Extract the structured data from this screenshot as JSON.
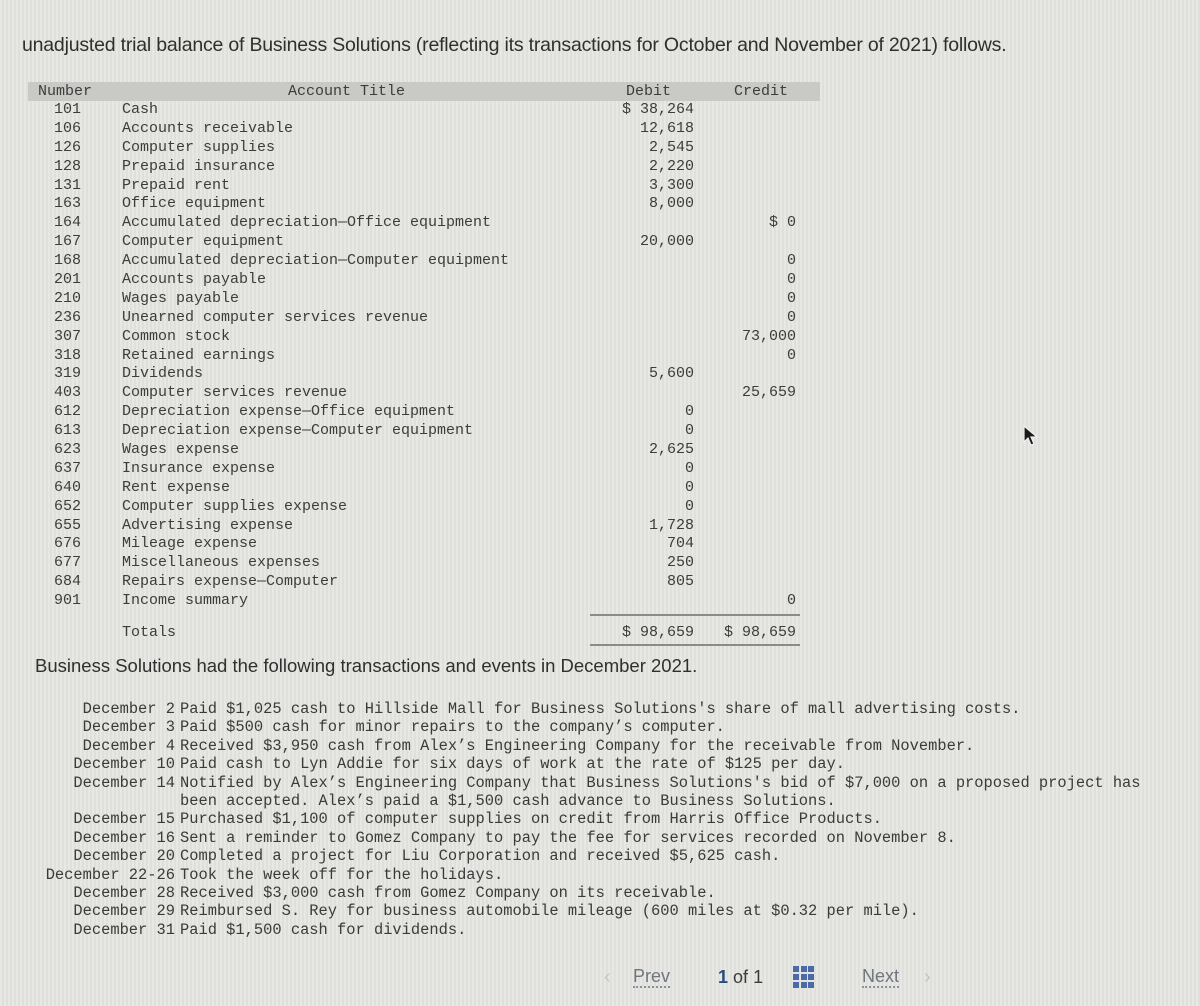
{
  "intro": "unadjusted trial balance of Business Solutions (reflecting its transactions for October and November of 2021) follows.",
  "trial_balance": {
    "headers": {
      "number": "Number",
      "title": "Account Title",
      "debit": "Debit",
      "credit": "Credit"
    },
    "rows": [
      {
        "number": "101",
        "title": "Cash",
        "debit": "$ 38,264",
        "credit": ""
      },
      {
        "number": "106",
        "title": "Accounts receivable",
        "debit": "12,618",
        "credit": ""
      },
      {
        "number": "126",
        "title": "Computer supplies",
        "debit": "2,545",
        "credit": ""
      },
      {
        "number": "128",
        "title": "Prepaid insurance",
        "debit": "2,220",
        "credit": ""
      },
      {
        "number": "131",
        "title": "Prepaid rent",
        "debit": "3,300",
        "credit": ""
      },
      {
        "number": "163",
        "title": "Office equipment",
        "debit": "8,000",
        "credit": ""
      },
      {
        "number": "164",
        "title": "Accumulated depreciation—Office equipment",
        "debit": "",
        "credit": "$ 0"
      },
      {
        "number": "167",
        "title": "Computer equipment",
        "debit": "20,000",
        "credit": ""
      },
      {
        "number": "168",
        "title": "Accumulated depreciation—Computer equipment",
        "debit": "",
        "credit": "0"
      },
      {
        "number": "201",
        "title": "Accounts payable",
        "debit": "",
        "credit": "0"
      },
      {
        "number": "210",
        "title": "Wages payable",
        "debit": "",
        "credit": "0"
      },
      {
        "number": "236",
        "title": "Unearned computer services revenue",
        "debit": "",
        "credit": "0"
      },
      {
        "number": "307",
        "title": "Common stock",
        "debit": "",
        "credit": "73,000"
      },
      {
        "number": "318",
        "title": "Retained earnings",
        "debit": "",
        "credit": "0"
      },
      {
        "number": "319",
        "title": "Dividends",
        "debit": "5,600",
        "credit": ""
      },
      {
        "number": "403",
        "title": "Computer services revenue",
        "debit": "",
        "credit": "25,659"
      },
      {
        "number": "612",
        "title": "Depreciation expense—Office equipment",
        "debit": "0",
        "credit": ""
      },
      {
        "number": "613",
        "title": "Depreciation expense—Computer equipment",
        "debit": "0",
        "credit": ""
      },
      {
        "number": "623",
        "title": "Wages expense",
        "debit": "2,625",
        "credit": ""
      },
      {
        "number": "637",
        "title": "Insurance expense",
        "debit": "0",
        "credit": ""
      },
      {
        "number": "640",
        "title": "Rent expense",
        "debit": "0",
        "credit": ""
      },
      {
        "number": "652",
        "title": "Computer supplies expense",
        "debit": "0",
        "credit": ""
      },
      {
        "number": "655",
        "title": "Advertising expense",
        "debit": "1,728",
        "credit": ""
      },
      {
        "number": "676",
        "title": "Mileage expense",
        "debit": "704",
        "credit": ""
      },
      {
        "number": "677",
        "title": "Miscellaneous expenses",
        "debit": "250",
        "credit": ""
      },
      {
        "number": "684",
        "title": "Repairs expense—Computer",
        "debit": "805",
        "credit": ""
      },
      {
        "number": "901",
        "title": "Income summary",
        "debit": "",
        "credit": "0"
      }
    ],
    "totals": {
      "label": "Totals",
      "debit": "$ 98,659",
      "credit": "$ 98,659"
    }
  },
  "transactions_intro": "Business Solutions had the following transactions and events in December 2021.",
  "transactions": [
    {
      "date": "December 2",
      "text": "Paid $1,025 cash to Hillside Mall for Business Solutions's share of mall advertising costs."
    },
    {
      "date": "December 3",
      "text": "Paid $500 cash for minor repairs to the company’s computer."
    },
    {
      "date": "December 4",
      "text": "Received $3,950 cash from Alex’s Engineering Company for the receivable from November."
    },
    {
      "date": "December 10",
      "text": "Paid cash to Lyn Addie for six days of work at the rate of $125 per day."
    },
    {
      "date": "December 14",
      "text": "Notified by Alex’s Engineering Company that Business Solutions's bid of $7,000 on a proposed project has been accepted. Alex’s paid a $1,500 cash advance to Business Solutions."
    },
    {
      "date": "December 15",
      "text": "Purchased $1,100 of computer supplies on credit from Harris Office Products."
    },
    {
      "date": "December 16",
      "text": "Sent a reminder to Gomez Company to pay the fee for services recorded on November 8."
    },
    {
      "date": "December 20",
      "text": "Completed a project for Liu Corporation and received $5,625 cash."
    },
    {
      "date": "December 22-26",
      "text": "Took the week off for the holidays."
    },
    {
      "date": "December 28",
      "text": "Received $3,000 cash from Gomez Company on its receivable."
    },
    {
      "date": "December 29",
      "text": "Reimbursed S. Rey for business automobile mileage (600 miles at $0.32 per mile)."
    },
    {
      "date": "December 31",
      "text": "Paid $1,500 cash for dividends."
    }
  ],
  "pager": {
    "prev_label": "Prev",
    "current_page": "1",
    "of_label": "of",
    "total_pages": "1",
    "next_label": "Next",
    "prev_icon": "chevron-left-icon",
    "next_icon": "chevron-right-icon",
    "grid_icon": "grid-icon"
  },
  "colors": {
    "accent": "#4b6aa6",
    "header_bg": "#c9c9c6"
  }
}
